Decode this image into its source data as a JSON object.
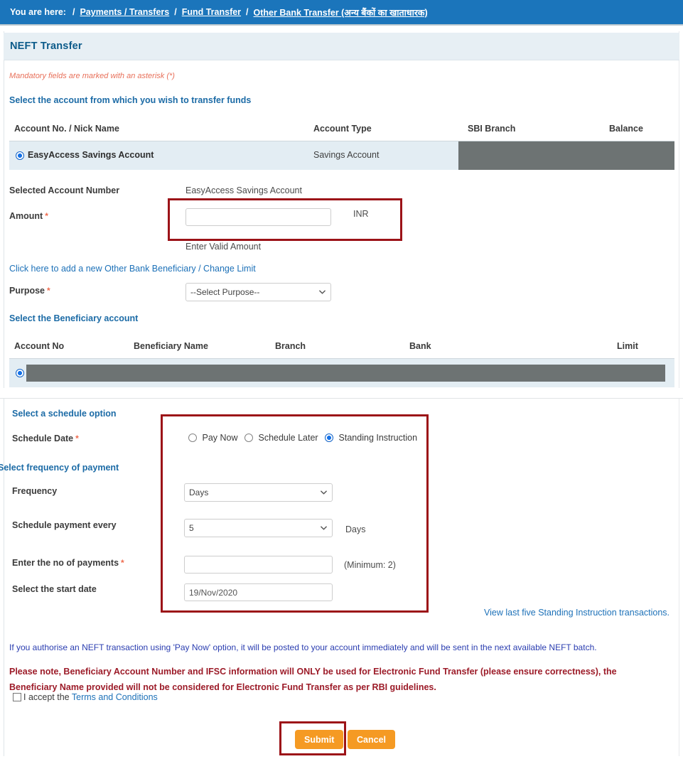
{
  "breadcrumb": {
    "prefix": "You are here:",
    "separator": "/",
    "items": [
      {
        "label": "Payments / Transfers"
      },
      {
        "label": "Fund Transfer"
      },
      {
        "label": "Other Bank Transfer (अन्य बैंकों का खाताधारक)"
      }
    ]
  },
  "page": {
    "title": "NEFT Transfer",
    "mandatory_note": "Mandatory fields are marked with an asterisk (*)"
  },
  "source_account": {
    "section_label": "Select the account from which you wish to transfer funds",
    "columns": [
      "Account No. / Nick Name",
      "Account Type",
      "SBI Branch",
      "Balance"
    ],
    "rows": [
      {
        "selected": true,
        "nick_name": "EasyAccess Savings Account",
        "account_type": "Savings Account",
        "sbi_branch": "",
        "balance": ""
      }
    ]
  },
  "selected_account": {
    "label": "Selected Account Number",
    "value": "EasyAccess Savings Account"
  },
  "amount": {
    "label": "Amount",
    "required": "*",
    "value": "",
    "placeholder": "",
    "currency": "INR",
    "hint": "Enter Valid Amount"
  },
  "add_beneficiary_link": "Click here to add a new Other Bank Beneficiary / Change Limit",
  "purpose": {
    "label": "Purpose",
    "required": "*",
    "selected": "--Select Purpose--",
    "options": [
      "--Select Purpose--"
    ]
  },
  "beneficiary": {
    "section_label": "Select the Beneficiary account",
    "columns": [
      "Account No",
      "Beneficiary Name",
      "Branch",
      "Bank",
      "Limit"
    ],
    "rows": [
      {
        "selected": true,
        "account_no": "",
        "beneficiary_name": "",
        "branch": "",
        "bank": "",
        "limit": ""
      }
    ]
  },
  "schedule": {
    "section_label": "Select a schedule option",
    "date_label": "Schedule Date",
    "date_required": "*",
    "options": [
      {
        "label": "Pay Now",
        "selected": false
      },
      {
        "label": "Schedule Later",
        "selected": false
      },
      {
        "label": "Standing Instruction",
        "selected": true
      }
    ]
  },
  "frequency_section": {
    "section_label": "Select frequency of payment",
    "frequency_label": "Frequency",
    "frequency_selected": "Days",
    "frequency_options": [
      "Days"
    ],
    "every_label": "Schedule payment every",
    "every_selected": "5",
    "every_options": [
      "5"
    ],
    "every_suffix": "Days",
    "payments_label": "Enter the no of payments",
    "payments_required": "*",
    "payments_value": "",
    "payments_hint": "(Minimum: 2)",
    "start_date_label": "Select the start date",
    "start_date_value": "19/Nov/2020"
  },
  "view_last_five_link": "View last five Standing Instruction transactions.",
  "notices": {
    "blue": "If you authorise an NEFT transaction using 'Pay Now' option, it will be posted to your account immediately and will be sent in the next available NEFT batch.",
    "red_line1": "Please note, Beneficiary Account Number and IFSC information will ONLY be used for Electronic Fund Transfer (please ensure correctness), the",
    "red_line2": "Beneficiary Name provided will not be considered for Electronic Fund Transfer as per RBI guidelines."
  },
  "terms": {
    "accept_prefix": "I accept the ",
    "link_text": "Terms and Conditions",
    "checked": false
  },
  "buttons": {
    "submit": "Submit",
    "cancel": "Cancel"
  },
  "colors": {
    "breadcrumb_bg": "#1b75bb",
    "band_bg": "#e7eff4",
    "heading_blue": "#1c6ba6",
    "link_blue": "#1d71b8",
    "redaction_gray": "#6d7373",
    "annotation_red": "#9c1318",
    "button_orange": "#f59a23",
    "notice_blue": "#2a3db0",
    "notice_red": "#9c1b28",
    "row_selected_bg": "#e3edf3"
  }
}
